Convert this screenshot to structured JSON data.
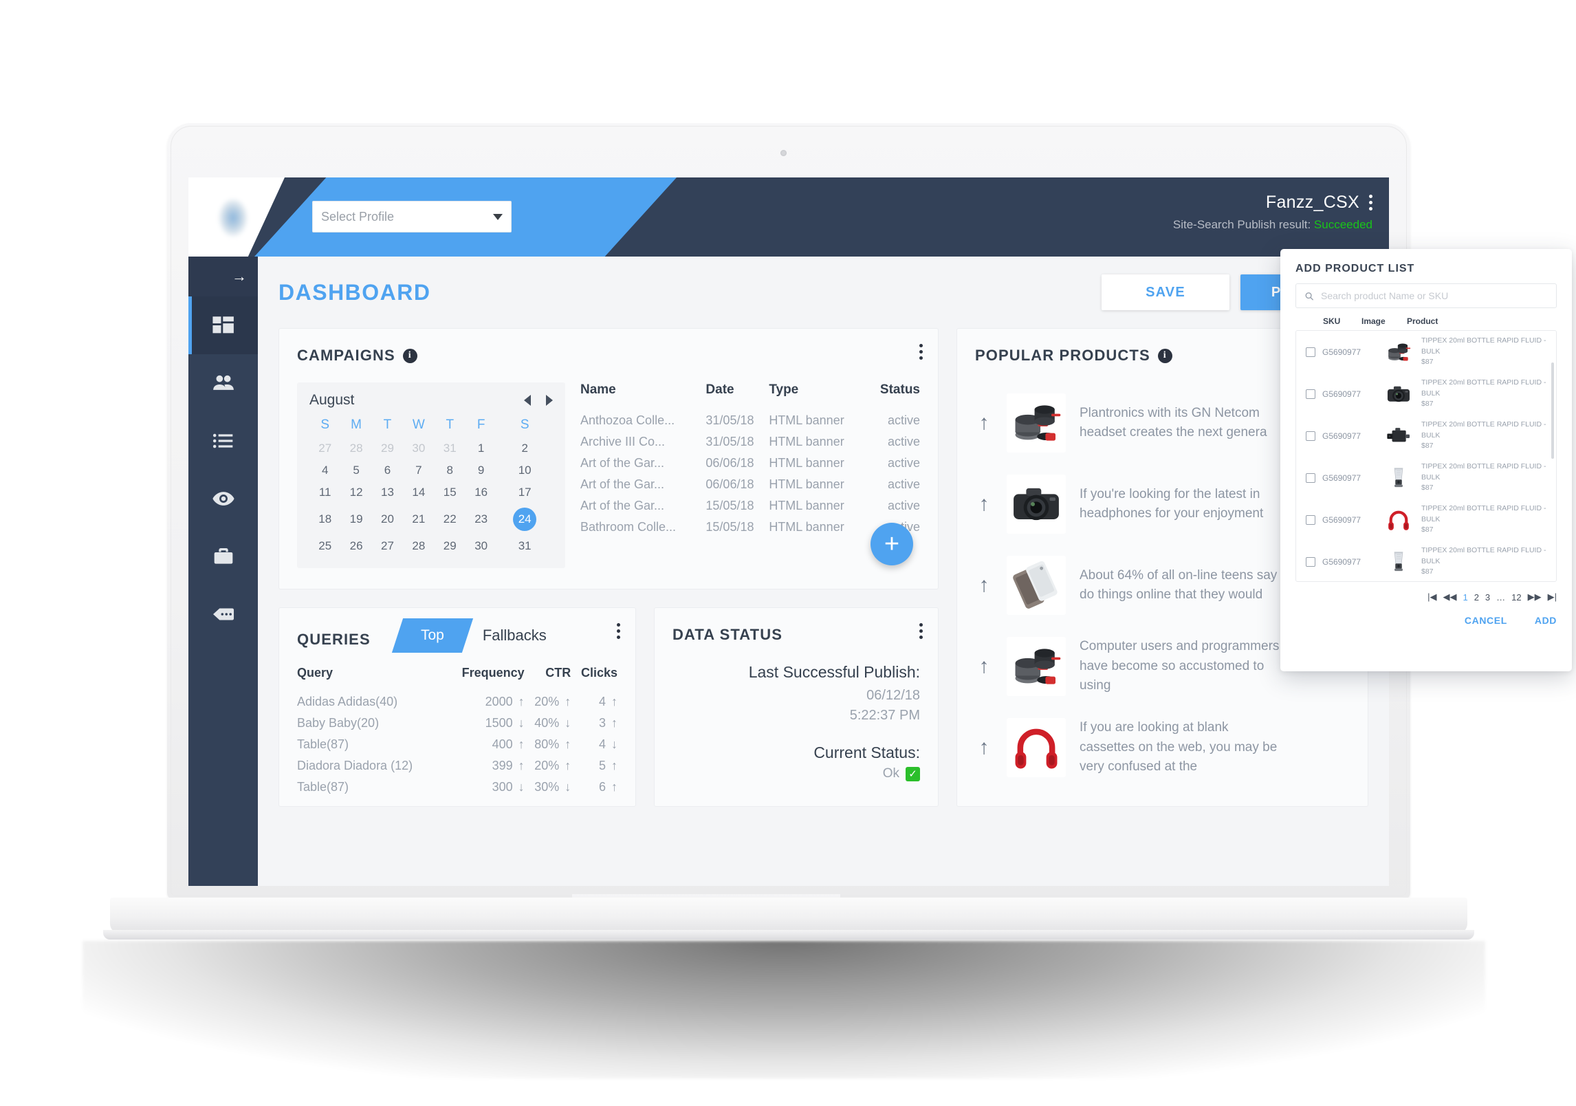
{
  "topbar": {
    "profile_select_placeholder": "Select Profile",
    "account_name": "Fanzz_CSX",
    "publish_label": "Site-Search Publish result:",
    "publish_result": "Succeeded",
    "publish_result_color": "#19c419"
  },
  "sidebar": {
    "collapse_icon": "arrow-right-icon",
    "items": [
      {
        "name": "dashboard",
        "icon": "dashboard-grid-icon",
        "active": true
      },
      {
        "name": "users",
        "icon": "users-icon",
        "active": false
      },
      {
        "name": "list",
        "icon": "list-icon",
        "active": false
      },
      {
        "name": "preview",
        "icon": "eye-icon",
        "active": false
      },
      {
        "name": "business",
        "icon": "briefcase-icon",
        "active": false
      },
      {
        "name": "more",
        "icon": "tag-ellipsis-icon",
        "active": false
      }
    ]
  },
  "page": {
    "title": "DASHBOARD",
    "save_label": "SAVE",
    "publish_label": "PUBLISH"
  },
  "campaigns": {
    "title": "CAMPAIGNS",
    "info_glyph": "i",
    "calendar": {
      "month": "August",
      "selected_day": 24,
      "weekdays": [
        "S",
        "M",
        "T",
        "W",
        "T",
        "F",
        "S"
      ],
      "weeks": [
        [
          {
            "d": 27,
            "muted": true
          },
          {
            "d": 28,
            "muted": true
          },
          {
            "d": 29,
            "muted": true
          },
          {
            "d": 30,
            "muted": true
          },
          {
            "d": 31,
            "muted": true
          },
          {
            "d": 1,
            "muted": false
          },
          {
            "d": 2,
            "muted": false
          }
        ],
        [
          {
            "d": 4,
            "muted": false
          },
          {
            "d": 5,
            "muted": false
          },
          {
            "d": 6,
            "muted": false
          },
          {
            "d": 7,
            "muted": false
          },
          {
            "d": 8,
            "muted": false
          },
          {
            "d": 9,
            "muted": false
          },
          {
            "d": 10,
            "muted": false
          }
        ],
        [
          {
            "d": 11,
            "muted": false
          },
          {
            "d": 12,
            "muted": false
          },
          {
            "d": 13,
            "muted": false
          },
          {
            "d": 14,
            "muted": false
          },
          {
            "d": 15,
            "muted": false
          },
          {
            "d": 16,
            "muted": false
          },
          {
            "d": 17,
            "muted": false
          }
        ],
        [
          {
            "d": 18,
            "muted": false
          },
          {
            "d": 19,
            "muted": false
          },
          {
            "d": 20,
            "muted": false
          },
          {
            "d": 21,
            "muted": false
          },
          {
            "d": 22,
            "muted": false
          },
          {
            "d": 23,
            "muted": false
          },
          {
            "d": 24,
            "muted": false
          }
        ],
        [
          {
            "d": 25,
            "muted": false
          },
          {
            "d": 26,
            "muted": false
          },
          {
            "d": 27,
            "muted": false
          },
          {
            "d": 28,
            "muted": false
          },
          {
            "d": 29,
            "muted": false
          },
          {
            "d": 30,
            "muted": false
          },
          {
            "d": 31,
            "muted": false
          }
        ]
      ]
    },
    "table": {
      "headers": [
        "Name",
        "Date",
        "Type",
        "Status"
      ],
      "rows": [
        [
          "Anthozoa Colle...",
          "31/05/18",
          "HTML banner",
          "active"
        ],
        [
          "Archive III Co...",
          "31/05/18",
          "HTML banner",
          "active"
        ],
        [
          "Art of the Gar...",
          "06/06/18",
          "HTML banner",
          "active"
        ],
        [
          "Art of the Gar...",
          "06/06/18",
          "HTML banner",
          "active"
        ],
        [
          "Art of the Gar...",
          "15/05/18",
          "HTML banner",
          "active"
        ],
        [
          "Bathroom Colle...",
          "15/05/18",
          "HTML banner",
          "active"
        ]
      ]
    },
    "fab_label": "+"
  },
  "queries": {
    "title": "QUERIES",
    "tabs": [
      {
        "label": "Top",
        "active": true
      },
      {
        "label": "Fallbacks",
        "active": false
      }
    ],
    "headers": [
      "Query",
      "Frequency",
      "CTR",
      "Clicks"
    ],
    "rows": [
      {
        "query": "Adidas Adidas(40)",
        "frequency": "2000",
        "frequency_trend": "↑",
        "ctr": "20%",
        "ctr_trend": "↑",
        "clicks": "4",
        "clicks_trend": "↑"
      },
      {
        "query": "Baby Baby(20)",
        "frequency": "1500",
        "frequency_trend": "↓",
        "ctr": "40%",
        "ctr_trend": "↓",
        "clicks": "3",
        "clicks_trend": "↑"
      },
      {
        "query": "Table(87)",
        "frequency": "400",
        "frequency_trend": "↑",
        "ctr": "80%",
        "ctr_trend": "↑",
        "clicks": "4",
        "clicks_trend": "↓"
      },
      {
        "query": "Diadora Diadora (12)",
        "frequency": "399",
        "frequency_trend": "↑",
        "ctr": "20%",
        "ctr_trend": "↑",
        "clicks": "5",
        "clicks_trend": "↑"
      },
      {
        "query": "Table(87)",
        "frequency": "300",
        "frequency_trend": "↓",
        "ctr": "30%",
        "ctr_trend": "↓",
        "clicks": "6",
        "clicks_trend": "↑"
      }
    ]
  },
  "data_status": {
    "title": "DATA STATUS",
    "last_publish_label": "Last Successful Publish:",
    "last_publish_date": "06/12/18",
    "last_publish_time": "5:22:37 PM",
    "current_status_label": "Current Status:",
    "current_status_value": "Ok",
    "current_status_icon": "green-check-icon"
  },
  "popular_products": {
    "title": "POPULAR PRODUCTS",
    "info_glyph": "i",
    "items": [
      {
        "trend": "↑",
        "image": "cookware-set-icon",
        "text": "Plantronics with its GN Netcom headset creates the next genera"
      },
      {
        "trend": "↑",
        "image": "dslr-camera-icon",
        "text": "If you're looking for the latest in headphones for your enjoyment"
      },
      {
        "trend": "↑",
        "image": "smartphones-icon",
        "text": "About 64% of all on-line teens say do things online that they would"
      },
      {
        "trend": "↑",
        "image": "cookware-set-icon",
        "text": "Computer users and programmers have become so accustomed to using"
      },
      {
        "trend": "↑",
        "image": "red-headphones-icon",
        "text": "If you are looking at blank cassettes on the web, you may be very confused at the"
      }
    ]
  },
  "modal": {
    "title": "ADD PRODUCT LIST",
    "search_placeholder": "Search product Name or SKU",
    "search_value": "",
    "search_icon": "search-icon",
    "headers": [
      "SKU",
      "Image",
      "Product"
    ],
    "rows": [
      {
        "sku": "G5690977",
        "image": "cookware-set-icon",
        "product": "TIPPEX 20ml BOTTLE RAPID FLUID - BULK",
        "price": "$87",
        "checked": false
      },
      {
        "sku": "G5690977",
        "image": "dslr-camera-icon",
        "product": "TIPPEX 20ml BOTTLE RAPID FLUID - BULK",
        "price": "$87",
        "checked": false
      },
      {
        "sku": "G5690977",
        "image": "video-camera-icon",
        "product": "TIPPEX 20ml BOTTLE RAPID FLUID - BULK",
        "price": "$87",
        "checked": false
      },
      {
        "sku": "G5690977",
        "image": "blender-icon",
        "product": "TIPPEX 20ml BOTTLE RAPID FLUID - BULK",
        "price": "$87",
        "checked": false
      },
      {
        "sku": "G5690977",
        "image": "red-headphones-icon",
        "product": "TIPPEX 20ml BOTTLE RAPID FLUID - BULK",
        "price": "$87",
        "checked": false
      },
      {
        "sku": "G5690977",
        "image": "blender-icon",
        "product": "TIPPEX 20ml BOTTLE RAPID FLUID - BULK",
        "price": "$87",
        "checked": false
      }
    ],
    "pager": {
      "first": "|◀",
      "prev": "◀◀",
      "pages": [
        "1",
        "2",
        "3",
        "…",
        "12"
      ],
      "current": "1",
      "next": "▶▶",
      "last": "▶|"
    },
    "cancel_label": "CANCEL",
    "add_label": "ADD"
  },
  "colors": {
    "accent_blue": "#4fa3f0",
    "navy": "#334158",
    "page_bg": "#f4f5f7",
    "card_bg": "#fafbfc",
    "muted_text": "#9aa2ad",
    "heading_text": "#36414f",
    "success_green": "#19c419"
  }
}
